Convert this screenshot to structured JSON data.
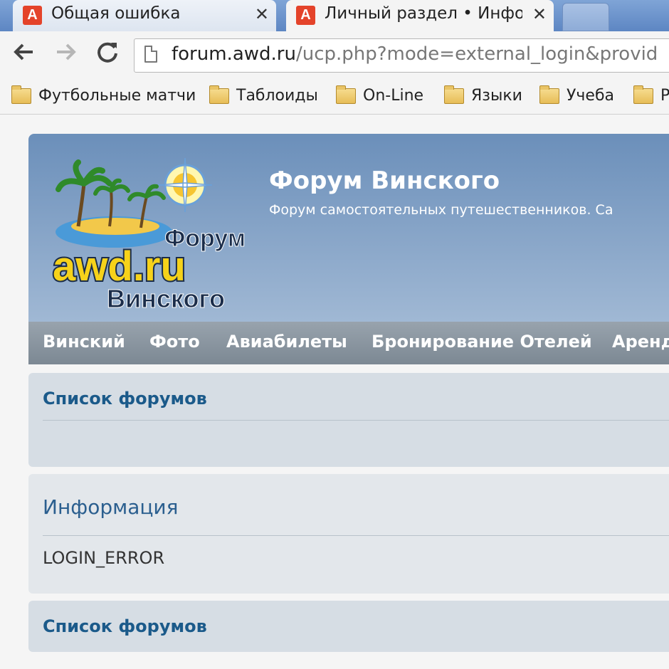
{
  "browser": {
    "tabs": [
      {
        "title": "Общая ошибка",
        "favicon": "A",
        "active": false
      },
      {
        "title": "Личный раздел • Инфор",
        "favicon": "A",
        "active": true
      }
    ],
    "url_host": "forum.awd.ru",
    "url_path": "/ucp.php?mode=external_login&provid",
    "bookmarks": [
      "Футбольные матчи",
      "Таблоиды",
      "On-Line",
      "Языки",
      "Учеба",
      "Р"
    ]
  },
  "site": {
    "title": "Форум Винского",
    "description": "Форум самостоятельных путешественников. Са",
    "logo_text": {
      "top": "Форум",
      "middle": "awd.ru",
      "bottom": "Винского"
    }
  },
  "nav": [
    "Винский",
    "Фото",
    "Авиабилеты",
    "Бронирование Отелей",
    "Аренд"
  ],
  "panels": {
    "forum_list_top": "Список форумов",
    "info_heading": "Информация",
    "info_message": "LOGIN_ERROR",
    "forum_list_bottom": "Список форумов"
  },
  "colors": {
    "favicon": "#e4432a",
    "header": "#6b8fba",
    "link": "#1b5a8a"
  }
}
